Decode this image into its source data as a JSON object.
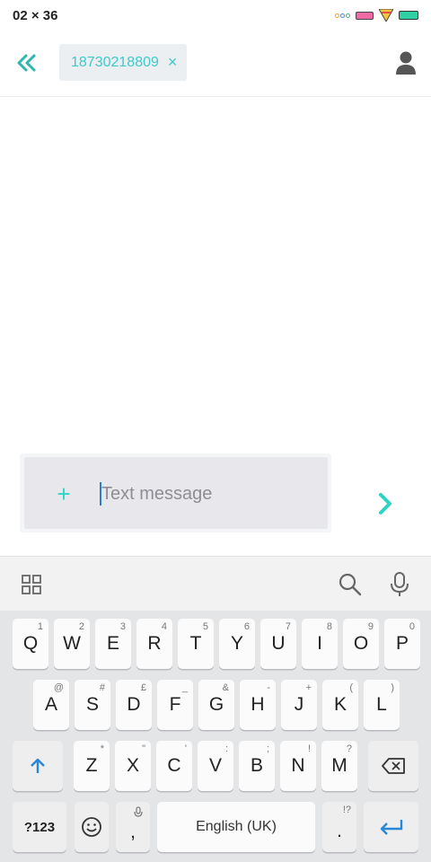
{
  "status_bar": {
    "time": "02 × 36"
  },
  "header": {
    "recipient": "18730218809",
    "recipient_remove": "×"
  },
  "composer": {
    "plus_label": "+",
    "placeholder": "Text message"
  },
  "keyboard": {
    "row1": [
      {
        "label": "Q",
        "hint": "1"
      },
      {
        "label": "W",
        "hint": "2"
      },
      {
        "label": "E",
        "hint": "3"
      },
      {
        "label": "R",
        "hint": "4"
      },
      {
        "label": "T",
        "hint": "5"
      },
      {
        "label": "Y",
        "hint": "6"
      },
      {
        "label": "U",
        "hint": "7"
      },
      {
        "label": "I",
        "hint": "8"
      },
      {
        "label": "O",
        "hint": "9"
      },
      {
        "label": "P",
        "hint": "0"
      }
    ],
    "row2": [
      {
        "label": "A",
        "hint": "@"
      },
      {
        "label": "S",
        "hint": "#"
      },
      {
        "label": "D",
        "hint": "£"
      },
      {
        "label": "F",
        "hint": "_"
      },
      {
        "label": "G",
        "hint": "&"
      },
      {
        "label": "H",
        "hint": "-"
      },
      {
        "label": "J",
        "hint": "+"
      },
      {
        "label": "K",
        "hint": "("
      },
      {
        "label": "L",
        "hint": ")"
      }
    ],
    "row3": [
      {
        "label": "Z",
        "hint": "*"
      },
      {
        "label": "X",
        "hint": "\""
      },
      {
        "label": "C",
        "hint": "'"
      },
      {
        "label": "V",
        "hint": ":"
      },
      {
        "label": "B",
        "hint": ";"
      },
      {
        "label": "N",
        "hint": "!"
      },
      {
        "label": "M",
        "hint": "?"
      }
    ],
    "symbols_label": "?123",
    "comma_label": ",",
    "space_label": "English (UK)",
    "period_label": ".",
    "period_hint": "!?"
  },
  "colors": {
    "accent": "#3dc9c9",
    "cursor": "#2a7dd4",
    "enter": "#2a86d6"
  }
}
